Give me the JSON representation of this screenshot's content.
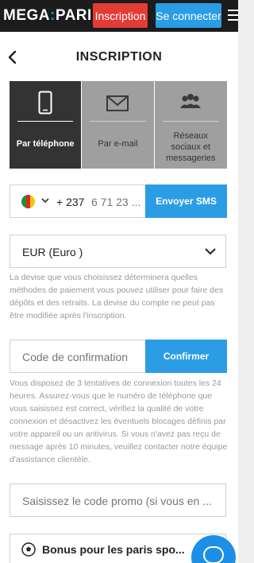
{
  "header": {
    "logo_left": "MEGA",
    "logo_sep": ":",
    "logo_right": "PARI",
    "signup_label": "Inscription",
    "login_label": "Se connecter",
    "colors": {
      "bar": "#1c1c1c",
      "signup": "#e23c37",
      "login": "#2b9de5"
    }
  },
  "page": {
    "title": "INSCRIPTION"
  },
  "tabs": [
    {
      "label": "Par téléphone",
      "icon": "phone-icon",
      "active": true
    },
    {
      "label": "Par e-mail",
      "icon": "envelope-icon",
      "active": false
    },
    {
      "label": "Réseaux sociaux et messageries",
      "icon": "people-icon",
      "active": false
    }
  ],
  "phone": {
    "country_flag": "cameroon-flag-icon",
    "dial_code": "+ 237",
    "placeholder": "6 71 23 ...",
    "send_sms_label": "Envoyer SMS"
  },
  "currency": {
    "selected": "EUR (Euro )",
    "note": "La devise que vous choisissez déterminera quelles méthodes de paiement vous pouvez utiliser pour faire des dépôts et des retraits. La devise du compte ne peut pas être modifiée après l'inscription."
  },
  "confirmation": {
    "placeholder": "Code de confirmation",
    "confirm_label": "Confirmer",
    "note": "Vous disposez de 3 tentatives de connexion toutes les 24 heures. Assurez-vous que le numéro de téléphone que vous saisissez est correct, vérifiez la qualité de votre connexion et désactivez les éventuels blocages définis par votre appareil ou un antivirus. Si vous n'avez pas reçu de message après 10 minutes, veuillez contacter notre équipe d'assistance clientèle."
  },
  "promo": {
    "placeholder": "Saisissez le code promo (si vous en ..."
  },
  "bonus": {
    "label": "Bonus pour les paris spo...",
    "icon": "soccer-ball-icon"
  },
  "chat": {
    "icon": "chat-icon"
  }
}
